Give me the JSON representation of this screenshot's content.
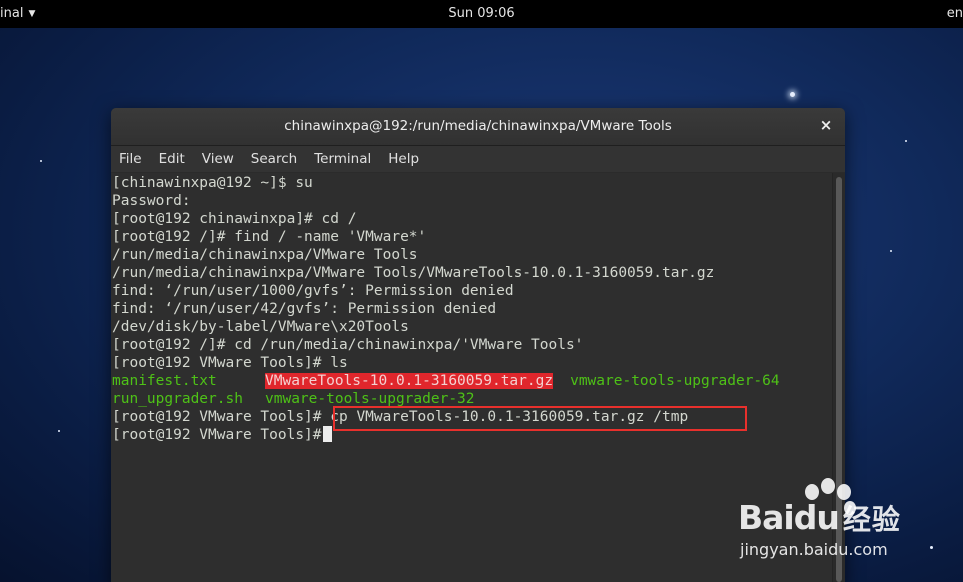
{
  "topbar": {
    "app_menu": "inal",
    "clock": "Sun 09:06",
    "right_label": "en"
  },
  "window": {
    "title": "chinawinxpa@192:/run/media/chinawinxpa/VMware Tools",
    "close_glyph": "×"
  },
  "menubar": {
    "items": [
      "File",
      "Edit",
      "View",
      "Search",
      "Terminal",
      "Help"
    ]
  },
  "terminal": {
    "lines": [
      "[chinawinxpa@192 ~]$ su",
      "Password:",
      "[root@192 chinawinxpa]# cd /",
      "[root@192 /]# find / -name 'VMware*'",
      "/run/media/chinawinxpa/VMware Tools",
      "/run/media/chinawinxpa/VMware Tools/VMwareTools-10.0.1-3160059.tar.gz",
      "find: ‘/run/user/1000/gvfs’: Permission denied",
      "find: ‘/run/user/42/gvfs’: Permission denied",
      "/dev/disk/by-label/VMware\\x20Tools",
      "[root@192 /]# cd /run/media/chinawinxpa/'VMware Tools'",
      "[root@192 VMware Tools]# ls"
    ],
    "ls_row1": {
      "file1": "manifest.txt",
      "file2": "VMwareTools-10.0.1-3160059.tar.gz",
      "file3": "vmware-tools-upgrader-64"
    },
    "ls_row2": {
      "file1": "run_upgrader.sh",
      "file2": "vmware-tools-upgrader-32"
    },
    "prompt": "[root@192 VMware Tools]#",
    "command": "cp VMwareTools-10.0.1-3160059.tar.gz /tmp",
    "final_prompt": "[root@192 VMware Tools]#"
  },
  "watermark": {
    "brand_latin": "Bai",
    "brand_du": "du",
    "brand_cn": "经验",
    "url": "jingyan.baidu.com"
  },
  "colors": {
    "terminal_bg": "#2e2e2e",
    "terminal_fg": "#d3d7cf",
    "exec_green": "#4ec117",
    "archive_red": "#e0262c",
    "annotation_red": "#e8302c"
  }
}
